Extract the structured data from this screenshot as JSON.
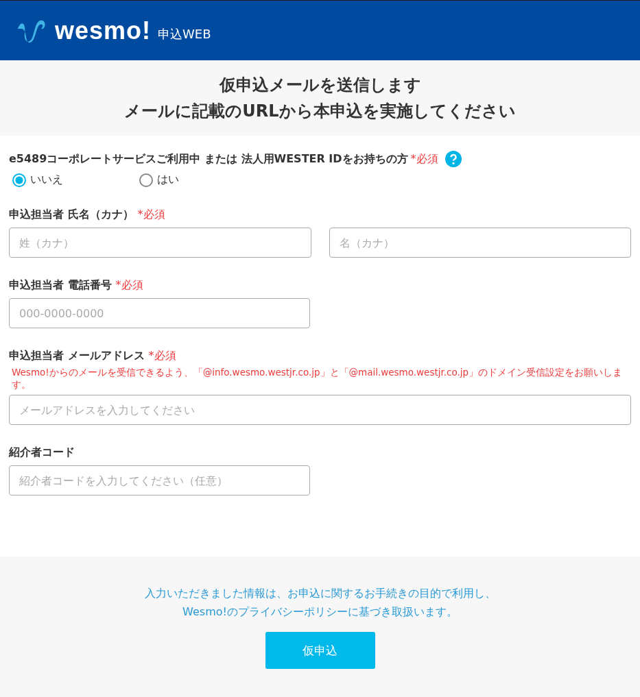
{
  "header": {
    "logo": "wesmo!",
    "subtitle": "申込WEB"
  },
  "title_lines": [
    "仮申込メールを送信します",
    "メールに記載のURLから本申込を実施してください"
  ],
  "question": {
    "label": "e5489コーポレートサービスご利用中 または 法人用WESTER IDをお持ちの方",
    "required": "*必須",
    "options": [
      {
        "label": "いいえ",
        "selected": true
      },
      {
        "label": "はい",
        "selected": false
      }
    ]
  },
  "fields": [
    {
      "kind": "pair",
      "label": "申込担当者 氏名（カナ）",
      "required": "*必須",
      "inputs": [
        {
          "placeholder": "姓（カナ）"
        },
        {
          "placeholder": "名（カナ）"
        }
      ]
    },
    {
      "kind": "short",
      "label": "申込担当者 電話番号",
      "required": "*必須",
      "inputs": [
        {
          "placeholder": "000-0000-0000"
        }
      ]
    },
    {
      "kind": "long",
      "label": "申込担当者 メールアドレス",
      "required": "*必須",
      "note": "Wesmo!からのメールを受信できるよう、「@info.wesmo.westjr.co.jp」と「@mail.wesmo.westjr.co.jp」のドメイン受信設定をお願いします。",
      "inputs": [
        {
          "placeholder": "メールアドレスを入力してください"
        }
      ]
    },
    {
      "kind": "short",
      "label": "紹介者コード",
      "inputs": [
        {
          "placeholder": "紹介者コードを入力してください（任意）"
        }
      ]
    }
  ],
  "notice_lines": [
    "入力いただきました情報は、お申込に関するお手続きの目的で利用し、",
    "Wesmo!のプライバシーポリシーに基づき取扱います。"
  ],
  "submit": "仮申込"
}
